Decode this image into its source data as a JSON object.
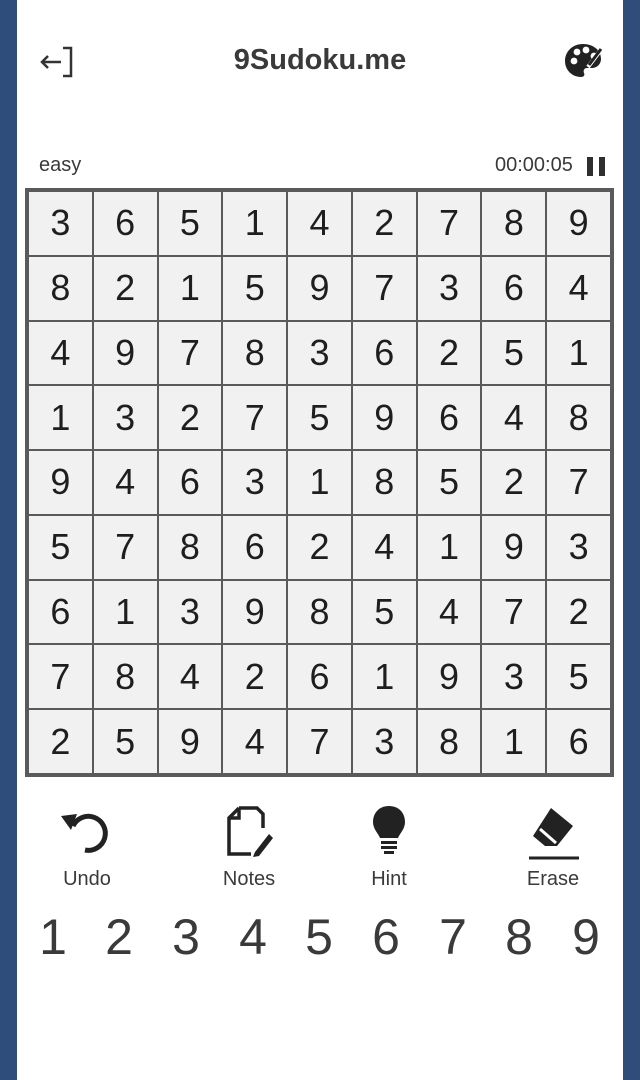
{
  "header": {
    "title": "9Sudoku.me",
    "exit_icon": "exit-icon",
    "theme_icon": "palette-icon"
  },
  "status": {
    "difficulty": "easy",
    "timer": "00:00:05",
    "pause_icon": "pause-icon"
  },
  "board": {
    "rows": [
      [
        "3",
        "6",
        "5",
        "1",
        "4",
        "2",
        "7",
        "8",
        "9"
      ],
      [
        "8",
        "2",
        "1",
        "5",
        "9",
        "7",
        "3",
        "6",
        "4"
      ],
      [
        "4",
        "9",
        "7",
        "8",
        "3",
        "6",
        "2",
        "5",
        "1"
      ],
      [
        "1",
        "3",
        "2",
        "7",
        "5",
        "9",
        "6",
        "4",
        "8"
      ],
      [
        "9",
        "4",
        "6",
        "3",
        "1",
        "8",
        "5",
        "2",
        "7"
      ],
      [
        "5",
        "7",
        "8",
        "6",
        "2",
        "4",
        "1",
        "9",
        "3"
      ],
      [
        "6",
        "1",
        "3",
        "9",
        "8",
        "5",
        "4",
        "7",
        "2"
      ],
      [
        "7",
        "8",
        "4",
        "2",
        "6",
        "1",
        "9",
        "3",
        "5"
      ],
      [
        "2",
        "5",
        "9",
        "4",
        "7",
        "3",
        "8",
        "1",
        "6"
      ]
    ]
  },
  "tools": {
    "undo": "Undo",
    "notes": "Notes",
    "hint": "Hint",
    "erase": "Erase"
  },
  "numpad": [
    "1",
    "2",
    "3",
    "4",
    "5",
    "6",
    "7",
    "8",
    "9"
  ],
  "colors": {
    "frame": "#2f4d7a",
    "grid_line": "#5a5a5a",
    "cell_bg": "#f1f1f1",
    "text": "#3a3a3a"
  }
}
